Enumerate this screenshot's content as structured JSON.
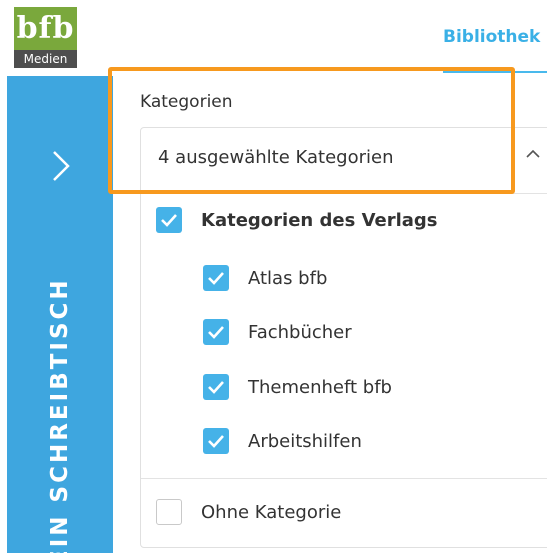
{
  "logo": {
    "mark": "bfb",
    "sub": "Medien"
  },
  "top_nav": {
    "active_tab": "Bibliothek"
  },
  "sidebar": {
    "label": "EIN SCHREIBTISCH",
    "expand_icon": "chevron-right-icon"
  },
  "category_field": {
    "label": "Kategorien",
    "value": "4 ausgewählte Kategorien",
    "caret_icon": "chevron-up-icon",
    "group": {
      "label": "Kategorien des Verlags",
      "checked": true
    },
    "items": [
      {
        "label": "Atlas bfb",
        "checked": true
      },
      {
        "label": "Fachbücher",
        "checked": true
      },
      {
        "label": "Themenheft bfb",
        "checked": true
      },
      {
        "label": "Arbeitshilfen",
        "checked": true
      }
    ],
    "none_option": {
      "label": "Ohne Kategorie",
      "checked": false
    }
  },
  "colors": {
    "accent": "#3ea6df",
    "checkbox": "#45b2e8",
    "highlight": "#f7991e",
    "logo": "#7aa83c"
  }
}
